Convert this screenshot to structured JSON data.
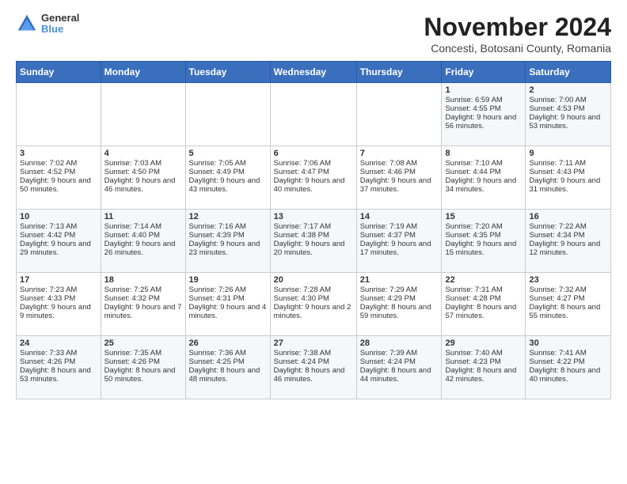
{
  "header": {
    "logo_general": "General",
    "logo_blue": "Blue",
    "month_title": "November 2024",
    "location": "Concesti, Botosani County, Romania"
  },
  "days_of_week": [
    "Sunday",
    "Monday",
    "Tuesday",
    "Wednesday",
    "Thursday",
    "Friday",
    "Saturday"
  ],
  "weeks": [
    [
      {
        "day": "",
        "sunrise": "",
        "sunset": "",
        "daylight": ""
      },
      {
        "day": "",
        "sunrise": "",
        "sunset": "",
        "daylight": ""
      },
      {
        "day": "",
        "sunrise": "",
        "sunset": "",
        "daylight": ""
      },
      {
        "day": "",
        "sunrise": "",
        "sunset": "",
        "daylight": ""
      },
      {
        "day": "",
        "sunrise": "",
        "sunset": "",
        "daylight": ""
      },
      {
        "day": "1",
        "sunrise": "Sunrise: 6:59 AM",
        "sunset": "Sunset: 4:55 PM",
        "daylight": "Daylight: 9 hours and 56 minutes."
      },
      {
        "day": "2",
        "sunrise": "Sunrise: 7:00 AM",
        "sunset": "Sunset: 4:53 PM",
        "daylight": "Daylight: 9 hours and 53 minutes."
      }
    ],
    [
      {
        "day": "3",
        "sunrise": "Sunrise: 7:02 AM",
        "sunset": "Sunset: 4:52 PM",
        "daylight": "Daylight: 9 hours and 50 minutes."
      },
      {
        "day": "4",
        "sunrise": "Sunrise: 7:03 AM",
        "sunset": "Sunset: 4:50 PM",
        "daylight": "Daylight: 9 hours and 46 minutes."
      },
      {
        "day": "5",
        "sunrise": "Sunrise: 7:05 AM",
        "sunset": "Sunset: 4:49 PM",
        "daylight": "Daylight: 9 hours and 43 minutes."
      },
      {
        "day": "6",
        "sunrise": "Sunrise: 7:06 AM",
        "sunset": "Sunset: 4:47 PM",
        "daylight": "Daylight: 9 hours and 40 minutes."
      },
      {
        "day": "7",
        "sunrise": "Sunrise: 7:08 AM",
        "sunset": "Sunset: 4:46 PM",
        "daylight": "Daylight: 9 hours and 37 minutes."
      },
      {
        "day": "8",
        "sunrise": "Sunrise: 7:10 AM",
        "sunset": "Sunset: 4:44 PM",
        "daylight": "Daylight: 9 hours and 34 minutes."
      },
      {
        "day": "9",
        "sunrise": "Sunrise: 7:11 AM",
        "sunset": "Sunset: 4:43 PM",
        "daylight": "Daylight: 9 hours and 31 minutes."
      }
    ],
    [
      {
        "day": "10",
        "sunrise": "Sunrise: 7:13 AM",
        "sunset": "Sunset: 4:42 PM",
        "daylight": "Daylight: 9 hours and 29 minutes."
      },
      {
        "day": "11",
        "sunrise": "Sunrise: 7:14 AM",
        "sunset": "Sunset: 4:40 PM",
        "daylight": "Daylight: 9 hours and 26 minutes."
      },
      {
        "day": "12",
        "sunrise": "Sunrise: 7:16 AM",
        "sunset": "Sunset: 4:39 PM",
        "daylight": "Daylight: 9 hours and 23 minutes."
      },
      {
        "day": "13",
        "sunrise": "Sunrise: 7:17 AM",
        "sunset": "Sunset: 4:38 PM",
        "daylight": "Daylight: 9 hours and 20 minutes."
      },
      {
        "day": "14",
        "sunrise": "Sunrise: 7:19 AM",
        "sunset": "Sunset: 4:37 PM",
        "daylight": "Daylight: 9 hours and 17 minutes."
      },
      {
        "day": "15",
        "sunrise": "Sunrise: 7:20 AM",
        "sunset": "Sunset: 4:35 PM",
        "daylight": "Daylight: 9 hours and 15 minutes."
      },
      {
        "day": "16",
        "sunrise": "Sunrise: 7:22 AM",
        "sunset": "Sunset: 4:34 PM",
        "daylight": "Daylight: 9 hours and 12 minutes."
      }
    ],
    [
      {
        "day": "17",
        "sunrise": "Sunrise: 7:23 AM",
        "sunset": "Sunset: 4:33 PM",
        "daylight": "Daylight: 9 hours and 9 minutes."
      },
      {
        "day": "18",
        "sunrise": "Sunrise: 7:25 AM",
        "sunset": "Sunset: 4:32 PM",
        "daylight": "Daylight: 9 hours and 7 minutes."
      },
      {
        "day": "19",
        "sunrise": "Sunrise: 7:26 AM",
        "sunset": "Sunset: 4:31 PM",
        "daylight": "Daylight: 9 hours and 4 minutes."
      },
      {
        "day": "20",
        "sunrise": "Sunrise: 7:28 AM",
        "sunset": "Sunset: 4:30 PM",
        "daylight": "Daylight: 9 hours and 2 minutes."
      },
      {
        "day": "21",
        "sunrise": "Sunrise: 7:29 AM",
        "sunset": "Sunset: 4:29 PM",
        "daylight": "Daylight: 8 hours and 59 minutes."
      },
      {
        "day": "22",
        "sunrise": "Sunrise: 7:31 AM",
        "sunset": "Sunset: 4:28 PM",
        "daylight": "Daylight: 8 hours and 57 minutes."
      },
      {
        "day": "23",
        "sunrise": "Sunrise: 7:32 AM",
        "sunset": "Sunset: 4:27 PM",
        "daylight": "Daylight: 8 hours and 55 minutes."
      }
    ],
    [
      {
        "day": "24",
        "sunrise": "Sunrise: 7:33 AM",
        "sunset": "Sunset: 4:26 PM",
        "daylight": "Daylight: 8 hours and 53 minutes."
      },
      {
        "day": "25",
        "sunrise": "Sunrise: 7:35 AM",
        "sunset": "Sunset: 4:26 PM",
        "daylight": "Daylight: 8 hours and 50 minutes."
      },
      {
        "day": "26",
        "sunrise": "Sunrise: 7:36 AM",
        "sunset": "Sunset: 4:25 PM",
        "daylight": "Daylight: 8 hours and 48 minutes."
      },
      {
        "day": "27",
        "sunrise": "Sunrise: 7:38 AM",
        "sunset": "Sunset: 4:24 PM",
        "daylight": "Daylight: 8 hours and 46 minutes."
      },
      {
        "day": "28",
        "sunrise": "Sunrise: 7:39 AM",
        "sunset": "Sunset: 4:24 PM",
        "daylight": "Daylight: 8 hours and 44 minutes."
      },
      {
        "day": "29",
        "sunrise": "Sunrise: 7:40 AM",
        "sunset": "Sunset: 4:23 PM",
        "daylight": "Daylight: 8 hours and 42 minutes."
      },
      {
        "day": "30",
        "sunrise": "Sunrise: 7:41 AM",
        "sunset": "Sunset: 4:22 PM",
        "daylight": "Daylight: 8 hours and 40 minutes."
      }
    ]
  ]
}
